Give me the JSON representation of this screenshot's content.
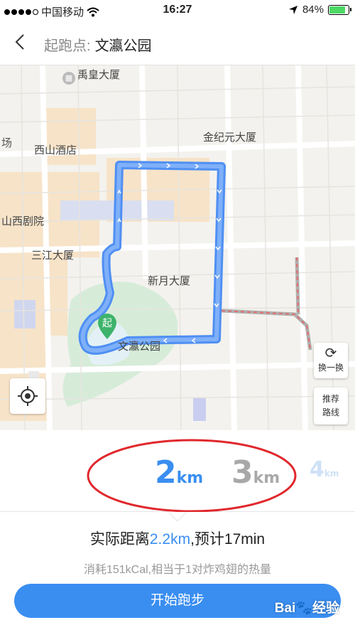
{
  "status_bar": {
    "carrier": "中国移动",
    "time": "16:27",
    "battery": "84%",
    "battery_level": 0.84
  },
  "nav": {
    "title_label": "起跑点:",
    "title_value": "文瀛公园"
  },
  "map": {
    "labels": {
      "yuhuang": "禹皇大厦",
      "chang": "场",
      "xishan_hotel": "西山酒店",
      "jinjiyuan": "金纪元大厦",
      "shanxi_theatre": "山西剧院",
      "sanjiang": "三江大厦",
      "xinyue": "新月大厦",
      "wenying_park": "文瀛公园"
    },
    "start_marker": "起",
    "refresh_label": "换一换",
    "recommend_label_1": "推荐",
    "recommend_label_2": "路线",
    "colors": {
      "route": "#5b9af5",
      "park": "#d6ecd9",
      "block": "#f7e3c8"
    }
  },
  "distance_picker": {
    "options": [
      {
        "num": "2",
        "unit": "km"
      },
      {
        "num": "3",
        "unit": "km"
      },
      {
        "num": "4",
        "unit": "km"
      }
    ],
    "selected_index": 0
  },
  "summary": {
    "prefix": "实际距离",
    "distance": "2.2km",
    "middle": ",预计",
    "eta": "17min",
    "calorie_text": "消耗151kCal,相当于1对炸鸡翅的热量"
  },
  "start_button": "开始跑步",
  "watermark": {
    "brand_a": "Bai",
    "brand_paw": "🐾",
    "brand_b": "经验"
  }
}
